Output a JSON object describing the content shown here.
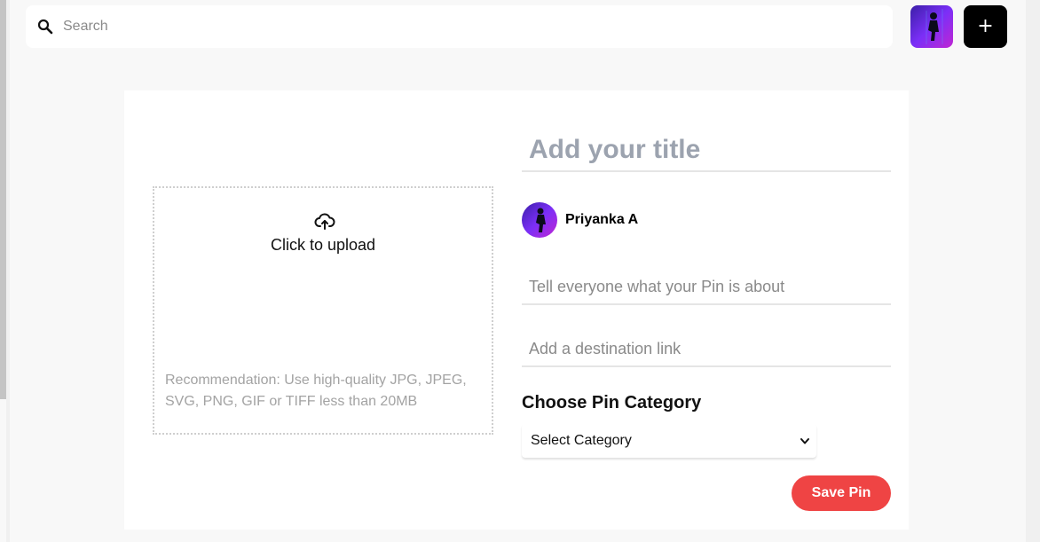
{
  "header": {
    "search": {
      "placeholder": "Search",
      "value": ""
    },
    "add_button_label": "+"
  },
  "upload": {
    "label": "Click to upload",
    "recommendation": "Recommendation: Use high-quality JPG, JPEG, SVG, PNG, GIF or TIFF less than 20MB"
  },
  "form": {
    "title_placeholder": "Add your title",
    "user_name": "Priyanka A",
    "about_placeholder": "Tell everyone what your Pin is about",
    "link_placeholder": "Add a destination link",
    "category_heading": "Choose Pin Category",
    "category_selected": "Select Category",
    "save_label": "Save Pin"
  },
  "colors": {
    "accent": "#ef4444",
    "dark_button": "#000000",
    "background": "#f8f8f8"
  },
  "icons": {
    "search": "search-icon",
    "upload": "cloud-upload-icon",
    "dropdown": "chevron-down-icon"
  }
}
